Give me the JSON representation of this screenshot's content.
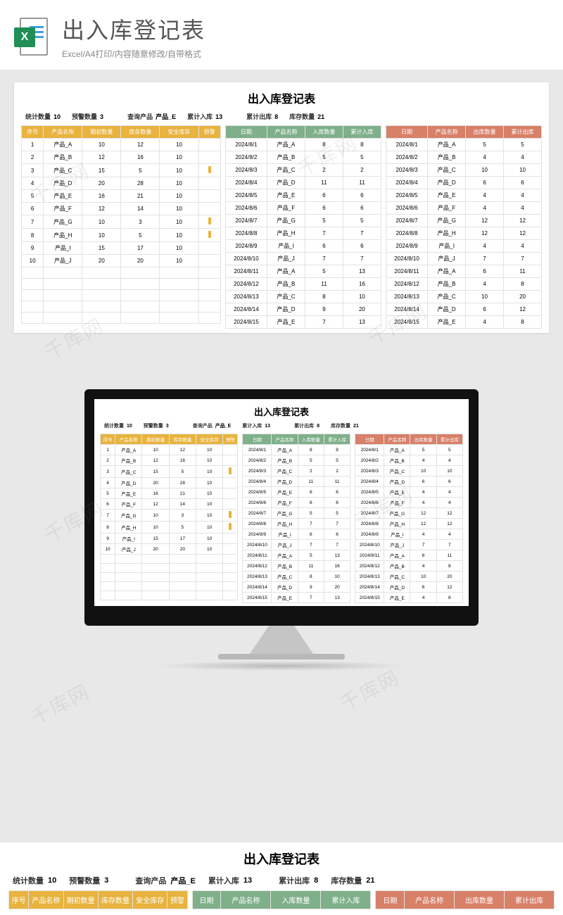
{
  "header": {
    "title": "出入库登记表",
    "subtitle": "Excel/A4打印/内容随意修改/自带格式",
    "icon_badge": "X"
  },
  "sheet": {
    "title": "出入库登记表",
    "summary": {
      "stat_count_label": "统计数量",
      "stat_count": "10",
      "warn_count_label": "预警数量",
      "warn_count": "3",
      "query_label": "查询产品",
      "query_value": "产品_E",
      "cum_in_label": "累计入库",
      "cum_in": "13",
      "cum_out_label": "累计出库",
      "cum_out": "8",
      "stock_label": "库存数量",
      "stock": "21"
    },
    "table1": {
      "headers": [
        "序号",
        "产品名称",
        "期初数量",
        "库存数量",
        "安全库存",
        "预警"
      ],
      "rows": [
        [
          "1",
          "产品_A",
          "10",
          "12",
          "10",
          ""
        ],
        [
          "2",
          "产品_B",
          "12",
          "16",
          "10",
          ""
        ],
        [
          "3",
          "产品_C",
          "15",
          "5",
          "10",
          "!"
        ],
        [
          "4",
          "产品_D",
          "20",
          "28",
          "10",
          ""
        ],
        [
          "5",
          "产品_E",
          "16",
          "21",
          "10",
          ""
        ],
        [
          "6",
          "产品_F",
          "12",
          "14",
          "10",
          ""
        ],
        [
          "7",
          "产品_G",
          "10",
          "3",
          "10",
          "!"
        ],
        [
          "8",
          "产品_H",
          "10",
          "5",
          "10",
          "!"
        ],
        [
          "9",
          "产品_I",
          "15",
          "17",
          "10",
          ""
        ],
        [
          "10",
          "产品_J",
          "20",
          "20",
          "10",
          ""
        ]
      ],
      "empty_rows": 5
    },
    "table2": {
      "headers": [
        "日期",
        "产品名称",
        "入库数量",
        "累计入库"
      ],
      "rows": [
        [
          "2024/8/1",
          "产品_A",
          "8",
          "8"
        ],
        [
          "2024/8/2",
          "产品_B",
          "5",
          "5"
        ],
        [
          "2024/8/3",
          "产品_C",
          "2",
          "2"
        ],
        [
          "2024/8/4",
          "产品_D",
          "11",
          "11"
        ],
        [
          "2024/8/5",
          "产品_E",
          "6",
          "6"
        ],
        [
          "2024/8/6",
          "产品_F",
          "6",
          "6"
        ],
        [
          "2024/8/7",
          "产品_G",
          "5",
          "5"
        ],
        [
          "2024/8/8",
          "产品_H",
          "7",
          "7"
        ],
        [
          "2024/8/9",
          "产品_I",
          "6",
          "6"
        ],
        [
          "2024/8/10",
          "产品_J",
          "7",
          "7"
        ],
        [
          "2024/8/11",
          "产品_A",
          "5",
          "13"
        ],
        [
          "2024/8/12",
          "产品_B",
          "11",
          "16"
        ],
        [
          "2024/8/13",
          "产品_C",
          "8",
          "10"
        ],
        [
          "2024/8/14",
          "产品_D",
          "9",
          "20"
        ],
        [
          "2024/8/15",
          "产品_E",
          "7",
          "13"
        ]
      ]
    },
    "table3": {
      "headers": [
        "日期",
        "产品名称",
        "出库数量",
        "累计出库"
      ],
      "rows": [
        [
          "2024/8/1",
          "产品_A",
          "5",
          "5"
        ],
        [
          "2024/8/2",
          "产品_B",
          "4",
          "4"
        ],
        [
          "2024/8/3",
          "产品_C",
          "10",
          "10"
        ],
        [
          "2024/8/4",
          "产品_D",
          "6",
          "6"
        ],
        [
          "2024/8/5",
          "产品_E",
          "4",
          "4"
        ],
        [
          "2024/8/6",
          "产品_F",
          "4",
          "4"
        ],
        [
          "2024/8/7",
          "产品_G",
          "12",
          "12"
        ],
        [
          "2024/8/8",
          "产品_H",
          "12",
          "12"
        ],
        [
          "2024/8/9",
          "产品_I",
          "4",
          "4"
        ],
        [
          "2024/8/10",
          "产品_J",
          "7",
          "7"
        ],
        [
          "2024/8/11",
          "产品_A",
          "6",
          "11"
        ],
        [
          "2024/8/12",
          "产品_B",
          "4",
          "8"
        ],
        [
          "2024/8/13",
          "产品_C",
          "10",
          "20"
        ],
        [
          "2024/8/14",
          "产品_D",
          "6",
          "12"
        ],
        [
          "2024/8/15",
          "产品_E",
          "4",
          "8"
        ]
      ]
    }
  },
  "watermark_text": "千库网"
}
